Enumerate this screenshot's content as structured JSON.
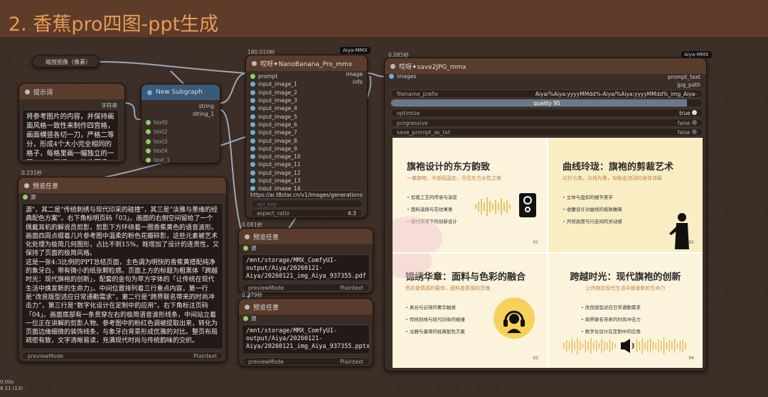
{
  "group": {
    "title": "2. 香蕉pro四图-ppt生成"
  },
  "resize_node": {
    "title": "缩放图像（像素）"
  },
  "prompt_node": {
    "title": "提示词",
    "output": "字符串",
    "text": "将参考图片的内容，并保持画面风格一致性来制作四宫格，画面横竖各切一刀，严格二等分，形成4个大小完全相同的格子，每格里画一幅独立的一页PPT，四幅PPT彼此不重叠，并且内容连贯，标题字体都"
  },
  "subgraph_node": {
    "title": "New Subgraph",
    "outputs": [
      "string",
      "string_1"
    ],
    "inputs": [
      "text0",
      "text2",
      "text3",
      "text4",
      "text_1"
    ]
  },
  "banana_node": {
    "timing": "180.010秒",
    "badge": "Aiya-MMX",
    "title": "哎呀✦NanoBanana_Pro_mmx",
    "inputs": [
      "prompt",
      "input_image_1",
      "input_image_2",
      "input_image_3",
      "input_image_4",
      "input_image_5",
      "input_image_6",
      "input_image_7",
      "input_image_8",
      "input_image_9",
      "input_image_10",
      "input_image_11",
      "input_image_12",
      "input_image_13",
      "input_image_14"
    ],
    "outputs": [
      "image",
      "info"
    ],
    "url": "https://ai.t8star.cn/v1/images/generations",
    "api_key": "api_key",
    "aspect_ratio_label": "aspect_ratio",
    "aspect_ratio_value": "4:3"
  },
  "save_node": {
    "timing": "0.085秒",
    "badge": "Aiya-MMX",
    "title": "哎呀✦save2JPG_mmx",
    "input": "images",
    "outputs": [
      "prompt_text",
      "jpg_path"
    ],
    "filename_prefix_label": "filename_prefix",
    "filename_prefix_value": "Aiya/%Aiya:yyyyMMdd%-Aiya/%Aiya:yyyyMMdd%_img_Aiya-",
    "quality_label": "quality",
    "quality_value": "95",
    "quality_fraction": 0.95,
    "optimize_label": "optimize",
    "optimize_value": "true",
    "progressive_label": "progressive",
    "progressive_value": "false",
    "save_prompt_label": "save_prompt_as_txt",
    "save_prompt_value": "false"
  },
  "preview_main": {
    "timing": "0.231秒",
    "title": "预览任意",
    "input": "源",
    "text": "源\"，其二是“传统刺绣与现代印采的碰撞”，其三是“淡雅与墨缘的经典配色方案”。右下角标明页码「03」。画面的右侧空间留给了一个佩戴耳机的解说员剪影，剪影下方环绕着一圈香蕉黄色的语音波形。画面四周点缀着几片参考图中温柔的粉色花瓣碎影，这些元素被艺术化处理为极简几何图形，占比不到15%，既增加了设计的连贯性，又保持了页面的极简风格。\n这是一张4:3比例的PPT总结页面，主色调为明快的香蕉黄搭配纯净的象牙白，带有微小的纸张颗粒感。页面上方的标题为粗黑体「跨越时光：现代旗袍的创新」，配套的金句为苹方字体的「让传统在现代生活中焕发新的生命力」。中间位置排列着三行重点内容，第一行是“改良版型适应日常通勤需求”，第二行是“跨界联名带来的时尚冲击力”，第三行是“数字化设计在定制中的应用”。右下角标注页码「04」。画面底部有一条贯穿左右的极简语音波形线条，中间站立着一位正在讲解的剪影人物。参考图中的粉红色调被提取出来，转化为页面边缘细微的装饰线条，与象牙白背景形成优雅的对比。整页布局疏密有致，文字清晰易读，充满现代时尚与传统韵味的交织。",
    "widget_label": "previewMode",
    "widget_value": "Plaintext"
  },
  "preview_pdf": {
    "timing": "0.081秒",
    "title": "预览任意",
    "input": "源",
    "text": "/mnt/storage/MMX_ComfyUI-output/Aiya/20260121-Aiya/20260121_img_Aiya_937355.pdf",
    "widget_label": "previewMode",
    "widget_value": "Plaintext"
  },
  "preview_pptx": {
    "timing": "0.279秒",
    "title": "预览任意",
    "input": "源",
    "text": "/mnt/storage/MMX_ComfyUI-output/Aiya/20260121-Aiya/20260121_img_Aiya_937355.pptx",
    "widget_label": "previewMode",
    "widget_value": "Plaintext"
  },
  "slides": [
    {
      "title": "旗袍设计的东方韵致",
      "subtitle": "一袭旗袍，半部民国史，尽显东方女性之美",
      "bullets": [
        "剪裁工艺的传承与演变",
        "面料选择与花纹寓意",
        "现代审美下的创新设计"
      ],
      "page": "01",
      "icon": "speaker-icon"
    },
    {
      "title": "曲线玲珑：旗袍的剪裁艺术",
      "subtitle": "以针为笔，以线为墨，勾勒出流动的身体诗篇",
      "bullets": [
        "立体与盘扣的细节美学",
        "收腰设计对曲线的极致雕琢",
        "开衩高度与行走间的灵动感"
      ],
      "page": "02",
      "icon": "speaker-silhouette-icon"
    },
    {
      "title": "锦绣华章：面料与色彩的融合",
      "subtitle": "色彩是情感的载体，面料是质感的灵魂",
      "bullets": [
        "真丝与云锦的奢华触感",
        "传统刺绣与现代印染的碰撞",
        "淡雅与墨缘的经典配色方案"
      ],
      "page": "03",
      "icon": "headphones-icon"
    },
    {
      "title": "跨越时光：现代旗袍的创新",
      "subtitle": "让传统在现代生活中焕发新的生命力",
      "bullets": [
        "改良版型适应日常通勤需求",
        "跨界联名带来的时尚冲击力",
        "数字化设计在定制中的应用"
      ],
      "page": "04",
      "icon": "speaker-volume-icon"
    }
  ],
  "status": {
    "line1": "0.00s",
    "line2": "8 21 (13)"
  },
  "colors": {
    "accent": "#e89a55",
    "slide_bg": "#fbf3dc",
    "slide_yellow": "#f7d76a"
  }
}
